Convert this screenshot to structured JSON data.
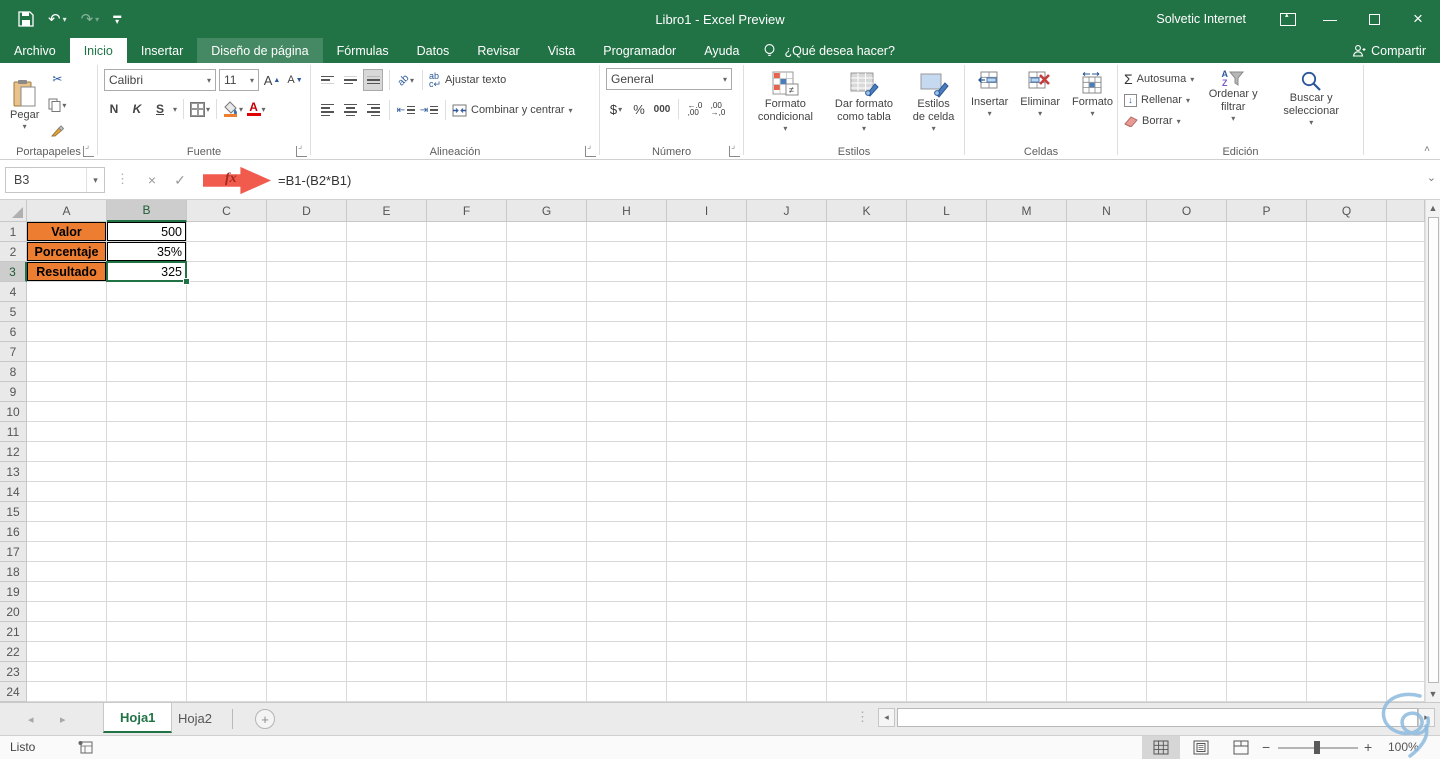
{
  "titlebar": {
    "title": "Libro1  -  Excel Preview",
    "account": "Solvetic Internet"
  },
  "tabs": {
    "archivo": "Archivo",
    "inicio": "Inicio",
    "insertar": "Insertar",
    "diseno": "Diseño de página",
    "formulas": "Fórmulas",
    "datos": "Datos",
    "revisar": "Revisar",
    "vista": "Vista",
    "programador": "Programador",
    "ayuda": "Ayuda",
    "tell_me": "¿Qué desea hacer?",
    "share": "Compartir"
  },
  "ribbon": {
    "clipboard": {
      "label": "Portapapeles",
      "paste": "Pegar"
    },
    "font": {
      "label": "Fuente",
      "family": "Calibri",
      "size": "11",
      "bold": "N",
      "italic": "K",
      "underline": "S"
    },
    "alignment": {
      "label": "Alineación",
      "wrap": "Ajustar texto",
      "merge": "Combinar y centrar"
    },
    "number": {
      "label": "Número",
      "format": "General",
      "currency": "$",
      "percent": "%",
      "thousands": "000"
    },
    "styles": {
      "label": "Estilos",
      "conditional": "Formato condicional",
      "table": "Dar formato como tabla",
      "cell": "Estilos de celda"
    },
    "cells": {
      "label": "Celdas",
      "insert": "Insertar",
      "delete": "Eliminar",
      "format": "Formato"
    },
    "editing": {
      "label": "Edición",
      "autosum": "Autosuma",
      "fill": "Rellenar",
      "clear": "Borrar",
      "sort": "Ordenar y filtrar",
      "find": "Buscar y seleccionar"
    }
  },
  "formula_bar": {
    "name_box": "B3",
    "formula": "=B1-(B2*B1)"
  },
  "grid": {
    "columns": [
      "A",
      "B",
      "C",
      "D",
      "E",
      "F",
      "G",
      "H",
      "I",
      "J",
      "K",
      "L",
      "M",
      "N",
      "O",
      "P",
      "Q"
    ],
    "row_count": 24,
    "selected_column": "B",
    "selected_row": 3,
    "cells": [
      {
        "row": 1,
        "col": "A",
        "text": "Valor",
        "type": "label"
      },
      {
        "row": 1,
        "col": "B",
        "text": "500",
        "type": "value"
      },
      {
        "row": 2,
        "col": "A",
        "text": "Porcentaje",
        "type": "label"
      },
      {
        "row": 2,
        "col": "B",
        "text": "35%",
        "type": "value"
      },
      {
        "row": 3,
        "col": "A",
        "text": "Resultado",
        "type": "label"
      },
      {
        "row": 3,
        "col": "B",
        "text": "325",
        "type": "value"
      }
    ],
    "colors": {
      "label_fill": "#ED7D31",
      "selection_border": "#217346"
    }
  },
  "sheet_tabs": {
    "sheet1": "Hoja1",
    "sheet2": "Hoja2",
    "active": "Hoja1"
  },
  "status_bar": {
    "mode": "Listo",
    "zoom": "100%"
  },
  "colors": {
    "chrome_green": "#217346",
    "arrow_red": "#F15B4E"
  }
}
